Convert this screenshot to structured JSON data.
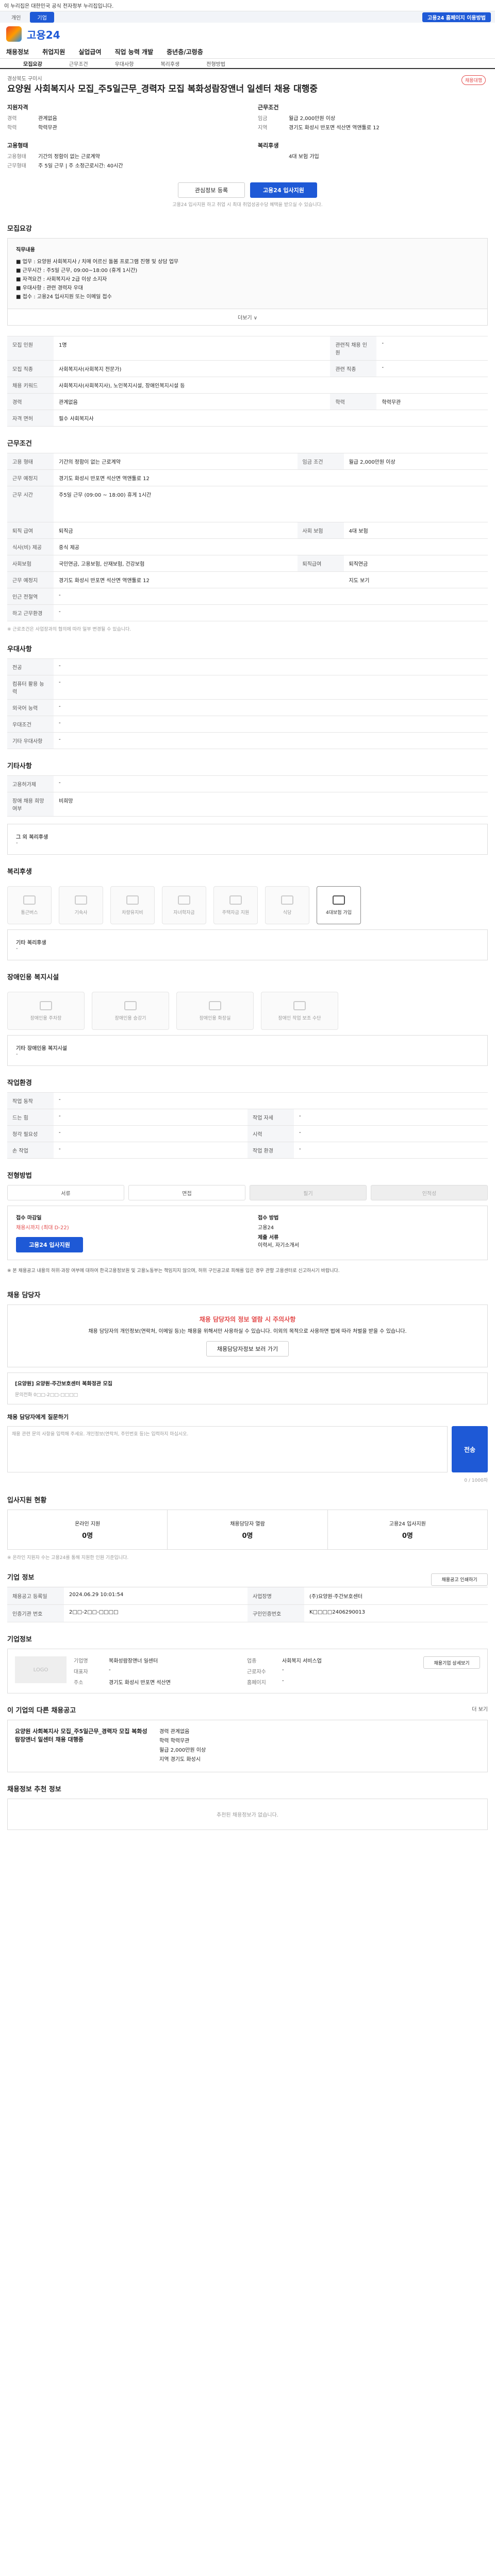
{
  "topbar": {
    "notice": "이 누리집은 대한민국 공식 전자정부 누리집입니다.",
    "tabs": [
      "개인",
      "기업"
    ],
    "right": "고용24 홈페이지 이용방법"
  },
  "logo": "고용24",
  "nav": [
    "채용정보",
    "취업지원",
    "실업급여",
    "직업 능력 개발",
    "중년층/고령층"
  ],
  "subnav": [
    "모집요강",
    "근무조건",
    "우대사항",
    "복리후생",
    "전형방법"
  ],
  "job": {
    "company": "경상북도 구미시",
    "title": "요양원 사회복지사 모집_주5일근무_경력자 모집 복화성람장앤너 일센터 채용 대행중",
    "badge": "채용대행"
  },
  "summary": {
    "left_title": "지원자격",
    "left": [
      {
        "k": "경력",
        "v": "관계없음"
      },
      {
        "k": "학력",
        "v": "학력무관"
      }
    ],
    "left_title2": "고용형태",
    "left2": [
      {
        "k": "고용형태",
        "v": "기간의 정함이 없는 근로계약"
      },
      {
        "k": "근무형태",
        "v": "주 5일 근무 | 주 소정근로시간: 40시간"
      }
    ],
    "right_title": "근무조건",
    "right": [
      {
        "k": "임금",
        "v": "월급 2,000만원 이상"
      },
      {
        "k": "지역",
        "v": "경기도 화성시 반포면 석산면 역앤툴로 12"
      }
    ],
    "right_title2": "복리후생",
    "right2": [
      {
        "k": "",
        "v": "4대 보험 가입"
      }
    ]
  },
  "buttons": {
    "scrap": "관심정보 등록",
    "apply": "고용24 입사지원"
  },
  "note": "고용24 입사지원 하고 취업 시 최대 취업성공수당 혜택을 받으실 수 있습니다.",
  "recruit": {
    "title": "모집요강",
    "desc_title": "직무내용",
    "desc": [
      "■ 업무 : 요양원 사회복지사 / 치매 어르신 돌봄 프로그램 진행 및 상담 업무",
      "■ 근무시간 : 주5일 근무, 09:00~18:00 (휴게 1시간)",
      "■ 자격요건 : 사회복지사 2급 이상 소지자",
      "■ 우대사항 : 관련 경력자 우대",
      "■ 접수 : 고용24 입사지원 또는 이메일 접수"
    ],
    "more": "더보기 ∨",
    "rows": [
      {
        "k": "모집 인원",
        "v": "1명",
        "k2": "관련직 채용 인원",
        "v2": "-"
      },
      {
        "k": "모집 직종",
        "v": "사회복지사(사회복지 전문가)",
        "k2": "관련 직종",
        "v2": "-"
      },
      {
        "k": "채용 키워드",
        "v": "사회복지사(사회복지사), 노인복지시설, 장애인복지시설 등",
        "k2": "",
        "v2": ""
      },
      {
        "k": "경력",
        "v": "관계없음",
        "k2": "학력",
        "v2": "학력무관"
      },
      {
        "k": "자격 면허",
        "v": "필수 사회복지사",
        "k2": "",
        "v2": ""
      }
    ]
  },
  "work": {
    "title": "근무조건",
    "rows": [
      {
        "k": "고용 형태",
        "v": "기간의 정함이 없는 근로계약",
        "k2": "임금 조건",
        "v2": "월급 2,000만원 이상"
      },
      {
        "k": "근무 예정지",
        "v": "경기도 화성시 반포면 석산면 역앤툴로 12",
        "k2": "",
        "v2": ""
      },
      {
        "k": "근무 시간",
        "v": "주5일 근무 (09:00 ~ 18:00) 휴게 1시간",
        "k2": "",
        "v2": ""
      },
      {
        "k": "퇴직 급여",
        "v": "퇴직금",
        "k2": "사회 보험",
        "v2": "4대 보험"
      },
      {
        "k": "식사(비) 제공",
        "v": "중식 제공",
        "k2": "",
        "v2": ""
      },
      {
        "k": "사회보험",
        "v": "국민연금, 고용보험, 산재보험, 건강보험",
        "k2": "퇴직급여",
        "v2": "퇴직연금"
      },
      {
        "k": "근무 예정지",
        "v": "경기도 화성시 반포면 석산면 역앤툴로 12",
        "k2": "",
        "v2": "지도 보기"
      },
      {
        "k": "인근 전철역",
        "v": "-",
        "k2": "",
        "v2": ""
      },
      {
        "k": "하고 근무환경",
        "v": "-",
        "k2": "",
        "v2": ""
      }
    ],
    "note": "※ 근로조건은 사업장과의 협의에 따라 일부 변경될 수 있습니다."
  },
  "pref": {
    "title": "우대사항",
    "rows": [
      {
        "k": "전공",
        "v": "-"
      },
      {
        "k": "컴퓨터 활용 능력",
        "v": "-"
      },
      {
        "k": "외국어 능력",
        "v": "-"
      },
      {
        "k": "우대조건",
        "v": "-"
      },
      {
        "k": "기타 우대사항",
        "v": "-"
      }
    ]
  },
  "etc": {
    "title": "기타사항",
    "rows": [
      {
        "k": "고용허가제",
        "v": "-"
      },
      {
        "k": "장애 채용 희망 여부",
        "v": "비희망"
      }
    ],
    "box_title": "그 외 복리후생",
    "box_value": "-"
  },
  "welfare": {
    "title": "복리후생",
    "items": [
      "통근버스",
      "기숙사",
      "차량유지비",
      "자녀학자금",
      "주택자금 지원",
      "식당",
      "4대보험 가입"
    ],
    "active": [
      6
    ],
    "box_title": "기타 복리후생",
    "box_value": "-"
  },
  "disabled": {
    "title": "장애인용 복지시설",
    "items": [
      "장애인용 주차장",
      "장애인용 승강기",
      "장애인용 화장실",
      "장애인 작업 보조 수단"
    ],
    "box_title": "기타 장애인용 복지시설",
    "box_value": "-"
  },
  "env": {
    "title": "작업환경",
    "rows": [
      {
        "k": "작업 동작",
        "v": "-",
        "k2": "",
        "v2": ""
      },
      {
        "k": "드는 힘",
        "v": "-",
        "k2": "작업 자세",
        "v2": "-"
      },
      {
        "k": "청각 필요성",
        "v": "-",
        "k2": "시력",
        "v2": "-"
      },
      {
        "k": "손 작업",
        "v": "-",
        "k2": "작업 환경",
        "v2": "-"
      }
    ]
  },
  "process": {
    "title": "전형방법",
    "steps": [
      "서류",
      "면접",
      "필기",
      "인적성"
    ],
    "off": [
      2,
      3
    ],
    "apply_k1": "접수 마감일",
    "apply_v1": "채용시까지 (최대 D-22)",
    "apply_k2": "접수 방법",
    "apply_v2": "고용24",
    "apply_btn": "고용24 입사지원",
    "doc_k": "제출 서류",
    "doc_v": "이력서, 자기소개서"
  },
  "disclaimer": "※ 본 채용공고 내용의 허위·과장 여부에 대하여 한국고용정보원 및 고용노동부는 책임지지 않으며, 허위 구인공고로 피해를 입은 경우 관할 고용센터로 신고하시기 바랍니다.",
  "contact": {
    "title": "채용 담당자",
    "warn_title": "채용 담당자의 정보 열람 시 주의사항",
    "warn_body": "채용 담당자의 개인정보(연락처, 이메일 등)는 채용을 위해서만 사용하실 수 있습니다. 이외의 목적으로 사용하면 법에 따라 처벌을 받을 수 있습니다.",
    "warn_btn": "채용담당자정보 보러 가기",
    "card_title": "[요양원] 요양원·주간보호센터 복화정관 모집",
    "card_sub": "문의전화 0□□-2□□-□□□□",
    "inquiry_title": "채용 담당자에게 질문하기",
    "inquiry_ph": "채용 관련 문의 사항을 입력해 주세요. 개인정보(연락처, 주민번호 등)는 입력하지 마십시오.",
    "inquiry_count": "0 / 1000자",
    "send": "전송"
  },
  "stats": {
    "title": "입사지원 현황",
    "items": [
      {
        "k": "온라인 지원",
        "v": "0명"
      },
      {
        "k": "채용담당자 열람",
        "v": "0명"
      },
      {
        "k": "고용24 입사지원",
        "v": "0명"
      }
    ],
    "sub": "※ 온라인 지원자 수는 고용24를 통해 지원한 인원 기준입니다."
  },
  "reg": {
    "title": "기업 정보",
    "print": "채용공고 인쇄하기",
    "rows": [
      {
        "k": "채용공고 등록일",
        "v": "2024.06.29 10:01:54",
        "k2": "사업장명",
        "v2": "(주)요양원·주간보호센터"
      },
      {
        "k": "인증기관 번호",
        "v": "2□□-2□□-□□□□",
        "k2": "구인인증번호",
        "v2": "K□□□□2406290013"
      }
    ]
  },
  "company": {
    "title": "기업정보",
    "logo_ph": "LOGO",
    "btn": "채용기업 상세보기",
    "rows": [
      {
        "k": "기업명",
        "v": "복화성람장앤너 일센터",
        "k2": "업종",
        "v2": "사회복지 서비스업"
      },
      {
        "k": "대표자",
        "v": "-",
        "k2": "근로자수",
        "v2": "-"
      },
      {
        "k": "주소",
        "v": "경기도 화성시 반포면 석산면",
        "k2": "홈페이지",
        "v2": "-"
      }
    ]
  },
  "similar": {
    "title": "이 기업의 다른 채용공고",
    "more": "더 보기",
    "card_title": "요양원 사회복지사 모집_주5일근무_경력자 모집 복화성람장앤너 일센터 채용 대행중",
    "rows": [
      "경력 관계없음",
      "학력 학력무관",
      "월급 2,000만원 이상",
      "지역 경기도 화성시"
    ]
  },
  "footer": {
    "title": "채용정보 추천 정보",
    "empty": "추천된 채용정보가 없습니다."
  }
}
